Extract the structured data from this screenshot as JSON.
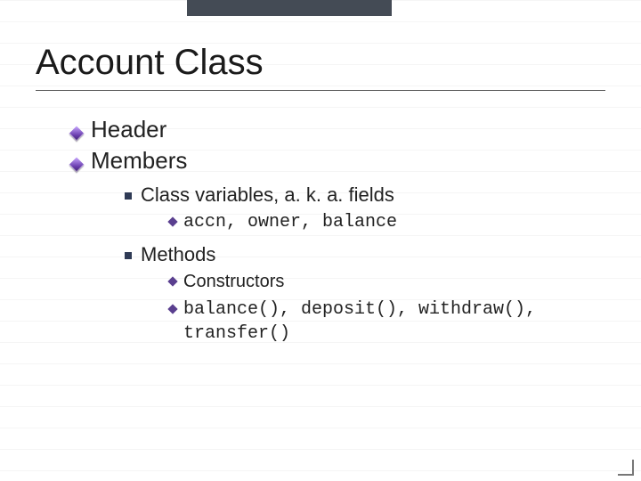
{
  "title": "Account Class",
  "bullets": {
    "header": "Header",
    "members": "Members",
    "classVars": "Class variables, a. k. a. fields",
    "classVarsDetail": "accn, owner, balance",
    "methods": "Methods",
    "constructors": "Constructors",
    "methodList": "balance(), deposit(), withdraw(), transfer()"
  }
}
